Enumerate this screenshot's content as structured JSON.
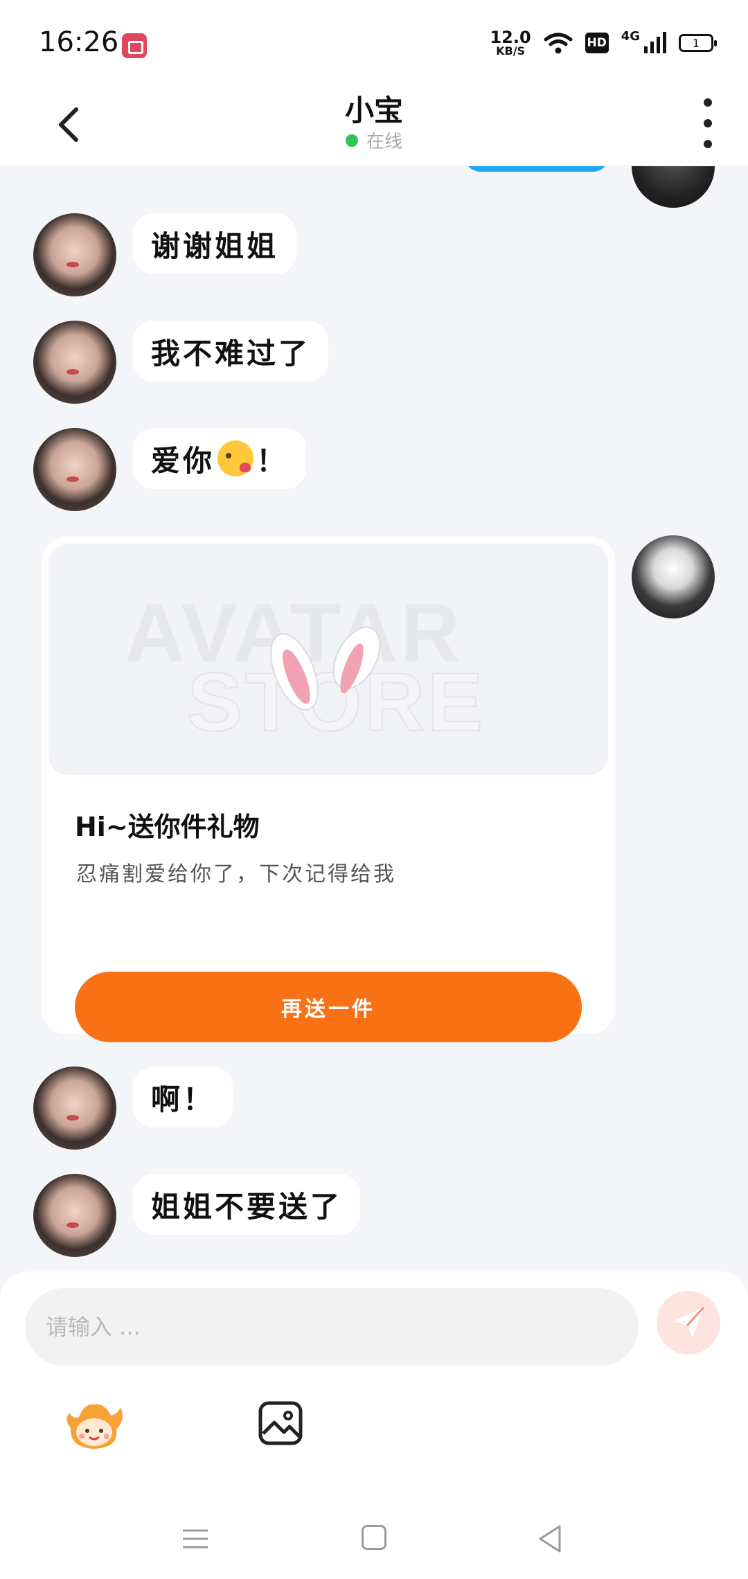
{
  "status_bar": {
    "time": "16:26",
    "net_speed_value": "12.0",
    "net_speed_unit": "KB/S",
    "hd_label": "HD",
    "network": "4G",
    "battery": "1"
  },
  "header": {
    "title": "小宝",
    "status": "在线"
  },
  "messages": [
    {
      "sender": "other",
      "text": "谢谢姐姐"
    },
    {
      "sender": "other",
      "text": "我不难过了"
    },
    {
      "sender": "other",
      "text_before": "爱你",
      "emoji": "kissing-face",
      "text_after": "！"
    },
    {
      "sender": "other",
      "text": "啊！"
    },
    {
      "sender": "other",
      "text": "姐姐不要送了"
    }
  ],
  "gift_card": {
    "watermark_1": "AVATAR",
    "watermark_2": "STORE",
    "title": "Hi~送你件礼物",
    "description": "忍痛割爱给你了，下次记得给我",
    "button_label": "再送一件"
  },
  "input": {
    "placeholder": "请输入 ..."
  },
  "colors": {
    "accent": "#f97115",
    "online": "#2cc650",
    "send_button_bg": "#fde4de",
    "send_icon": "#f88f80",
    "sent_bubble": "#1ea7f2"
  },
  "icons": [
    "back-icon",
    "more-icon",
    "send-icon",
    "mascot-icon",
    "image-icon",
    "menu-icon",
    "home-icon",
    "nav-back-icon"
  ]
}
